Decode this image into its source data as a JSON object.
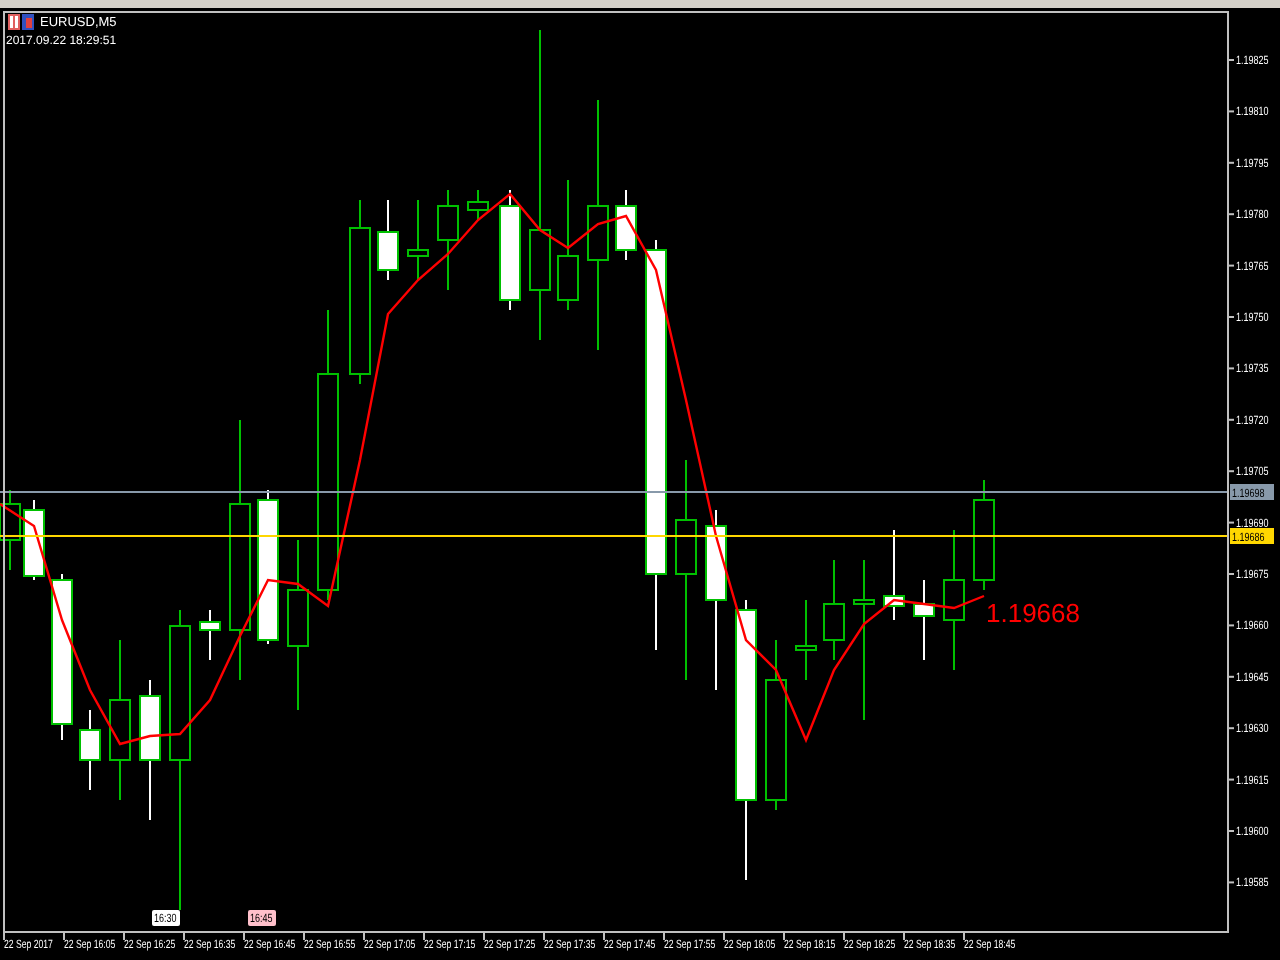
{
  "chart": {
    "symbol": "EURUSD,M5",
    "timestamp": "2017.09.22 18:29:51",
    "indicator_value": "1.19668",
    "price_axis": [
      "1.19825",
      "1.19810",
      "1.19795",
      "1.19780",
      "1.19765",
      "1.19750",
      "1.19735",
      "1.19720",
      "1.19705",
      "1.19690",
      "1.19675",
      "1.19660",
      "1.19645",
      "1.19630",
      "1.19615",
      "1.19600",
      "1.19585"
    ],
    "price_labels": [
      {
        "kind": "ask",
        "text": "1.19698",
        "color": "#8899aa"
      },
      {
        "kind": "bid",
        "text": "1.19686",
        "color": "#ffd700"
      }
    ],
    "time_axis": [
      "22 Sep 2017",
      "22 Sep 16:05",
      "22 Sep 16:25",
      "22 Sep 16:35",
      "22 Sep 16:45",
      "22 Sep 16:55",
      "22 Sep 17:05",
      "22 Sep 17:15",
      "22 Sep 17:25",
      "22 Sep 17:35",
      "22 Sep 17:45",
      "22 Sep 17:55",
      "22 Sep 18:05",
      "22 Sep 18:15",
      "22 Sep 18:25",
      "22 Sep 18:35",
      "22 Sep 18:45"
    ],
    "time_markers": [
      {
        "text": "16:30",
        "color": "#ffffff"
      },
      {
        "text": "16:45",
        "color": "#ffc0cb"
      }
    ]
  }
}
